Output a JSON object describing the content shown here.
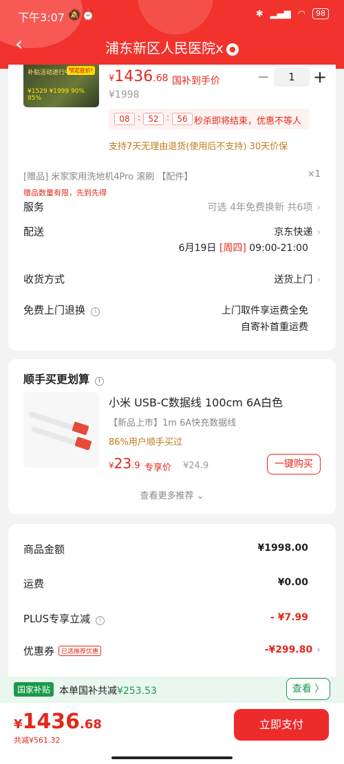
{
  "status": {
    "time": "下午3:07",
    "icons": [
      "bluetooth-icon",
      "signal-icon",
      "wifi-icon"
    ],
    "battery": "98"
  },
  "nav": {
    "title": "浦东新区人民医院x"
  },
  "product": {
    "thumb_badge": "锁定底价!",
    "thumb_price": "¥1529 ¥1999 90% 85%",
    "thumb_line": "补贴活动进行中",
    "currency": "¥",
    "price_int": "1436",
    "price_dec": ".68",
    "subsidy_label": "国补到手价",
    "original_price": "¥1998",
    "quantity": "1",
    "countdown": {
      "h": "08",
      "m": "52",
      "s": "56"
    },
    "flash_text": "秒杀即将结束，优惠不等人",
    "return_policy": "支持7天无理由退货(使用后不支持) 30天价保"
  },
  "gift": {
    "text": "[赠品]  米家家用洗地机4Pro 滚刷 【配件】",
    "qty": "×1",
    "note": "赠品数量有限，先到先得"
  },
  "rows": {
    "service_label": "服务",
    "service_value": "可选 4年免费换新 共6项",
    "delivery_label": "配送",
    "delivery_value": "京东快递",
    "delivery_date": "6月19日",
    "delivery_weekday": "[周四]",
    "delivery_time": "09:00-21:00",
    "receive_label": "收货方式",
    "receive_value": "送货上门",
    "return_label": "免费上门退换",
    "return_value1": "上门取件享运费全免",
    "return_value2": "自寄补首重运费"
  },
  "addon": {
    "title": "顺手买更划算",
    "name": "小米 USB-C数据线 100cm 6A白色",
    "desc": "【新品上市】1m 6A快充数据线",
    "percent": "86%用户顺手买过",
    "currency": "¥",
    "price_int": "23",
    "price_dec": ".9",
    "price_tag": "专享价",
    "old_price": "¥24.9",
    "buy_label": "一键购买",
    "more_label": "查看更多推荐"
  },
  "summary": {
    "amount_label": "商品金额",
    "amount_value": "¥1998.00",
    "shipping_label": "运费",
    "shipping_value": "¥0.00",
    "plus_label": "PLUS专享立减",
    "plus_value": "- ¥7.99",
    "coupon_label": "优惠券",
    "coupon_badge": "已选推荐优惠",
    "coupon_value": "-¥299.80"
  },
  "subsidy_bar": {
    "tag": "国家补贴",
    "text": "本单国补共减",
    "amount": "¥253.53",
    "view_label": "查看 〉"
  },
  "footer": {
    "currency": "¥",
    "total_int": "1436",
    "total_dec": ".68",
    "saved": "共减¥561.32",
    "pay_label": "立即支付"
  },
  "colors": {
    "brand_red": "#f2322c",
    "price_red": "#e4281c",
    "subsidy_green": "#1a9a4a",
    "gold": "#c27a1a"
  }
}
